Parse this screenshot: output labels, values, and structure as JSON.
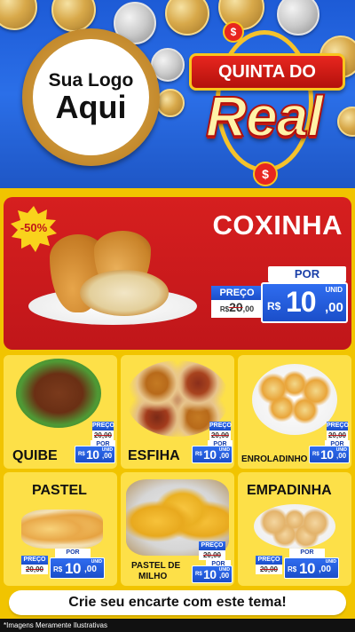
{
  "logo": {
    "line1": "Sua Logo",
    "line2": "Aqui"
  },
  "badge": {
    "title": "QUINTA DO",
    "word": "Real",
    "currency_symbol": "$"
  },
  "featured": {
    "discount": "-50%",
    "name": "COXINHA",
    "old_price_label": "PREÇO",
    "old_price_currency": "R$",
    "old_price_int": "20",
    "old_price_dec": ",00",
    "new_price_label": "POR",
    "new_price_currency": "R$",
    "new_price_int": "10",
    "new_price_dec": ",00",
    "unit": "UNID"
  },
  "products": [
    {
      "name": "QUIBE",
      "old_label": "PREÇO",
      "old_price": "20,00",
      "new_label": "POR",
      "currency": "R$",
      "price_int": "10",
      "price_dec": ",00",
      "unit": "UNID"
    },
    {
      "name": "ESFIHA",
      "old_label": "PREÇO",
      "old_price": "20,00",
      "new_label": "POR",
      "currency": "R$",
      "price_int": "10",
      "price_dec": ",00",
      "unit": "UNID"
    },
    {
      "name": "ENROLADINHO",
      "old_label": "PREÇO",
      "old_price": "20,00",
      "new_label": "POR",
      "currency": "R$",
      "price_int": "10",
      "price_dec": ",00",
      "unit": "UNID"
    },
    {
      "name": "PASTEL",
      "old_label": "PREÇO",
      "old_price": "20,00",
      "new_label": "POR",
      "currency": "R$",
      "price_int": "10",
      "price_dec": ",00",
      "unit": "UNID"
    },
    {
      "name_line1": "PASTEL DE",
      "name_line2": "MILHO",
      "old_label": "PREÇO",
      "old_price": "20,00",
      "new_label": "POR",
      "currency": "R$",
      "price_int": "10",
      "price_dec": ",00",
      "unit": "UNID"
    },
    {
      "name": "EMPADINHA",
      "old_label": "PREÇO",
      "old_price": "20,00",
      "new_label": "POR",
      "currency": "R$",
      "price_int": "10",
      "price_dec": ",00",
      "unit": "UNID"
    }
  ],
  "footer": {
    "cta": "Crie seu encarte com este tema!",
    "disclaimer": "*Imagens Meramente Ilustrativas"
  },
  "colors": {
    "hero_blue": "#1d5bd6",
    "feature_red": "#c0161a",
    "card_yellow": "#fde048",
    "price_blue": "#1b4ec9",
    "background_yellow": "#f1c400"
  }
}
